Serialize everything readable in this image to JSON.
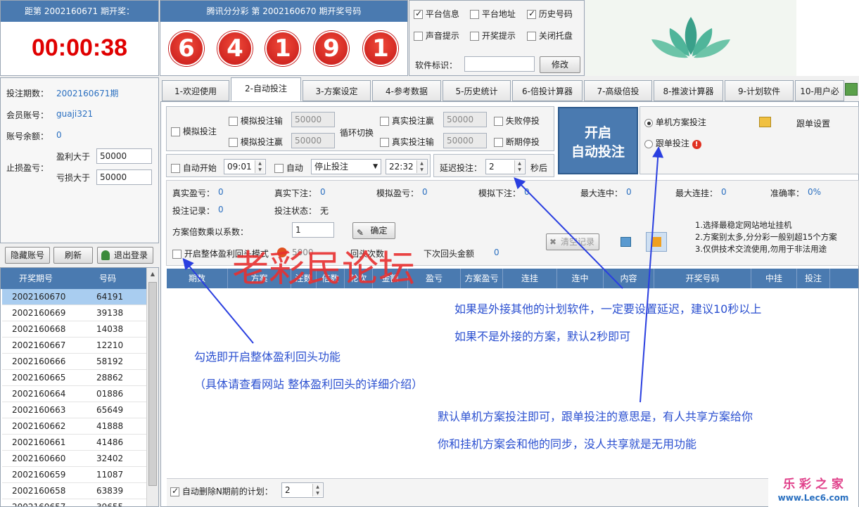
{
  "countdown": {
    "title": "距第 2002160671 期开奖：",
    "time": "00:00:38"
  },
  "draw": {
    "title": "腾讯分分彩 第 2002160670 期开奖号码",
    "balls": [
      "6",
      "4",
      "1",
      "9",
      "1"
    ]
  },
  "options": {
    "items": [
      {
        "label": "平台信息",
        "checked": true
      },
      {
        "label": "平台地址",
        "checked": false
      },
      {
        "label": "历史号码",
        "checked": true
      },
      {
        "label": "声音提示",
        "checked": false
      },
      {
        "label": "开奖提示",
        "checked": false
      },
      {
        "label": "关闭托盘",
        "checked": false
      }
    ],
    "software_id_label": "软件标识：",
    "modify_button": "修改"
  },
  "account": {
    "period_label": "投注期数：",
    "period_value": "2002160671期",
    "member_label": "会员账号：",
    "member_value": "guaji321",
    "balance_label": "账号余额：",
    "balance_value": "0",
    "stop_label": "止损盈亏：",
    "profit_label": "盈利大于",
    "profit_value": "50000",
    "loss_label": "亏损大于",
    "loss_value": "50000"
  },
  "left_buttons": {
    "hide": "隐藏账号",
    "refresh": "刷新",
    "logout": "退出登录"
  },
  "history": {
    "headers": [
      "开奖期号",
      "号码"
    ],
    "rows": [
      [
        "2002160670",
        "64191"
      ],
      [
        "2002160669",
        "39138"
      ],
      [
        "2002160668",
        "14038"
      ],
      [
        "2002160667",
        "12210"
      ],
      [
        "2002160666",
        "58192"
      ],
      [
        "2002160665",
        "28862"
      ],
      [
        "2002160664",
        "01886"
      ],
      [
        "2002160663",
        "65649"
      ],
      [
        "2002160662",
        "41888"
      ],
      [
        "2002160661",
        "41486"
      ],
      [
        "2002160660",
        "32402"
      ],
      [
        "2002160659",
        "11087"
      ],
      [
        "2002160658",
        "63839"
      ],
      [
        "2002160657",
        "39655"
      ]
    ]
  },
  "tabs": [
    "1-欢迎使用",
    "2-自动投注",
    "3-方案设定",
    "4-参考数据",
    "5-历史统计",
    "6-倍投计算器",
    "7-高级倍投",
    "8-推波计算器",
    "9-计划软件",
    "10-用户必"
  ],
  "sim": {
    "sim_bet": "模拟投注",
    "sim_lose": "模拟投注输",
    "sim_win": "模拟投注赢",
    "sim_lose_val": "50000",
    "sim_win_val": "50000",
    "cycle": "循环切换",
    "real_win": "真实投注赢",
    "real_lose": "真实投注输",
    "real_win_val": "50000",
    "real_lose_val": "50000",
    "fail_stop": "失败停投",
    "break_stop": "断期停投"
  },
  "start_button": {
    "line1": "开启",
    "line2": "自动投注"
  },
  "mode": {
    "single": "单机方案投注",
    "follow": "跟单投注",
    "follow_settings": "跟单设置"
  },
  "auto": {
    "auto_start": "自动开始",
    "start_time": "09:01",
    "auto": "自动",
    "action": "停止投注",
    "end_time": "22:32",
    "delay_label": "延迟投注：",
    "delay_value": "2",
    "delay_unit": "秒后"
  },
  "stats": {
    "real_pl": "真实盈亏：",
    "real_pl_v": "0",
    "real_bet": "真实下注：",
    "real_bet_v": "0",
    "sim_pl": "模拟盈亏：",
    "sim_pl_v": "0",
    "sim_bet": "模拟下注：",
    "sim_bet_v": "0",
    "max_win": "最大连中：",
    "max_win_v": "0",
    "max_lose": "最大连挂：",
    "max_lose_v": "0",
    "accuracy": "准确率：",
    "accuracy_v": "0%",
    "record": "投注记录：",
    "record_v": "0",
    "status": "投注状态：",
    "status_v": "无",
    "multiplier": "方案倍数乘以系数：",
    "multiplier_v": "1",
    "confirm": "确定",
    "clear": "清空记录"
  },
  "notice": [
    "1.选择最稳定网站地址挂机",
    "2.方案别太多,分分彩一般别超15个方案",
    "3.仅供技术交流使用,勿用于非法用途"
  ],
  "rollback": {
    "label": "开启整体盈利回头模式",
    "amount": "5000",
    "times": "回头次数",
    "next": "下次回头金额",
    "next_v": "0"
  },
  "table_headers": [
    "期数",
    "方案",
    "注数",
    "倍数",
    "轮次",
    "金额",
    "盈亏",
    "方案盈亏",
    "连挂",
    "连中",
    "内容",
    "开奖号码",
    "中挂",
    "投注"
  ],
  "bottom": {
    "label": "自动删除N期前的计划：",
    "value": "2"
  },
  "watermark": "老彩民论坛",
  "annotations": {
    "a1": "如果是外接其他的计划软件，一定要设置延迟，建议10秒以上",
    "a2": "如果不是外接的方案，默认2秒即可",
    "a3": "勾选即开启整体盈利回头功能",
    "a4": "（具体请查看网站  整体盈利回头的详细介绍）",
    "a5": "默认单机方案投注即可，跟单投注的意思是，有人共享方案给你",
    "a6": "你和挂机方案会和他的同步，没人共享就是无用功能"
  },
  "logo": {
    "line1": "乐 彩 之 家",
    "line2": "www.Lec6.com"
  },
  "colors": {
    "header": "#4a7ab0",
    "accent_blue": "#2a6fc0",
    "countdown_red": "#e00000",
    "ball_red": "#d42020"
  }
}
